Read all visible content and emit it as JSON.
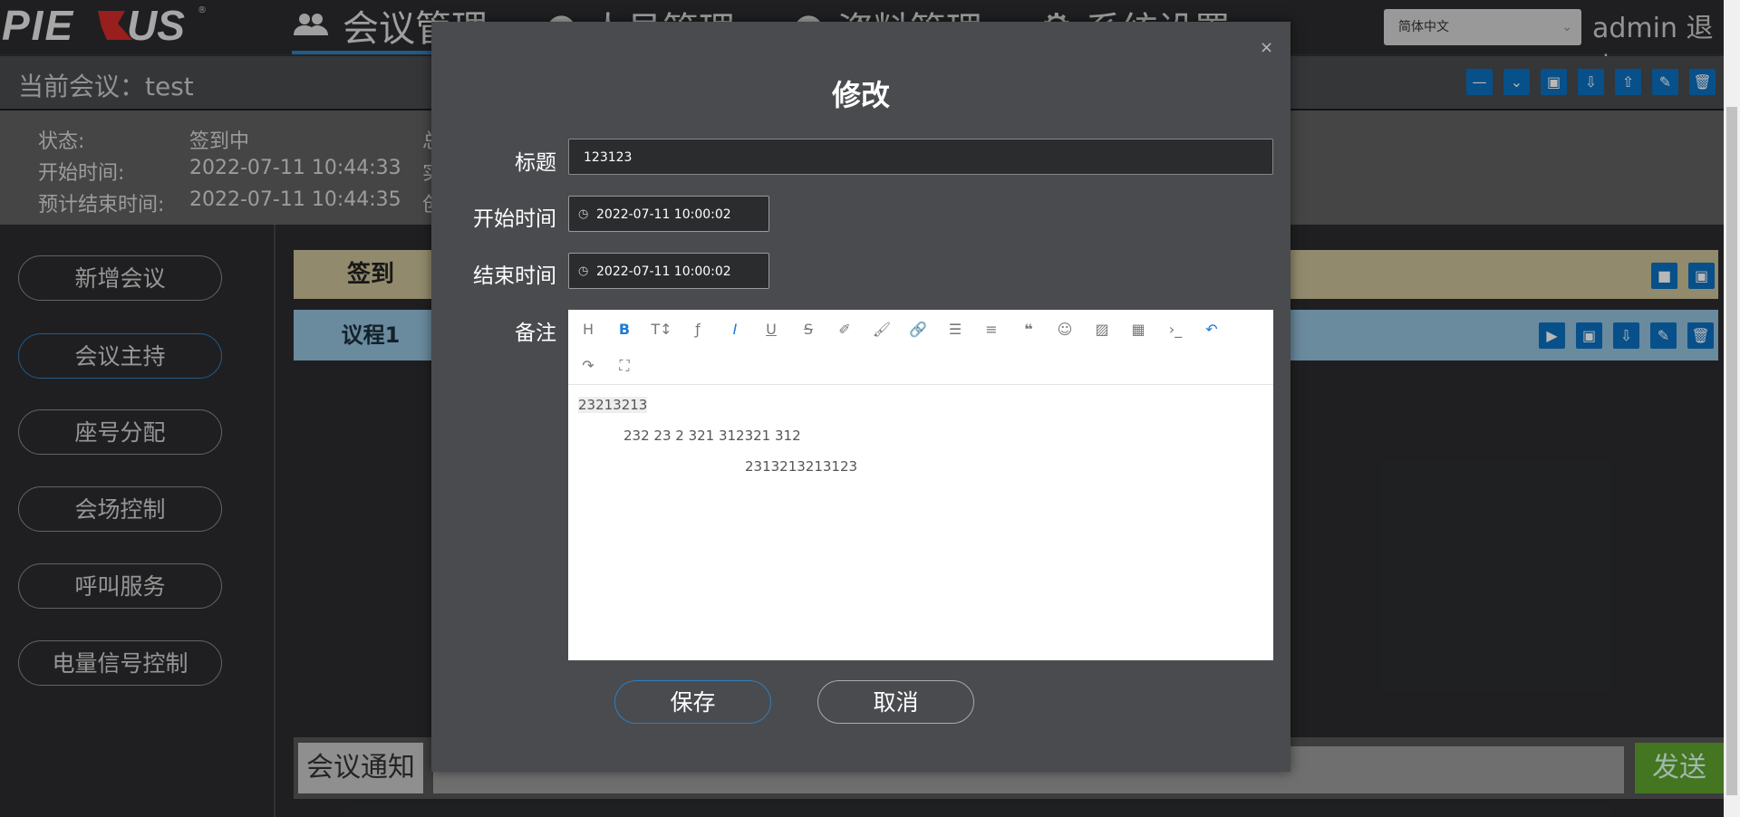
{
  "logo": "PIEXUS",
  "nav": [
    {
      "label": "会议管理",
      "icon": "users-icon"
    },
    {
      "label": "人员管理",
      "icon": "person-icon"
    },
    {
      "label": "资料管理",
      "icon": "person-icon"
    },
    {
      "label": "系统设置",
      "icon": "gear-icon"
    }
  ],
  "language": "简体中文",
  "user": {
    "name": "admin",
    "logout": "退出"
  },
  "conference": {
    "label": "当前会议：",
    "name": "test"
  },
  "info": {
    "status_key": "状态:",
    "status_val": "签到中",
    "start_key": "开始时间:",
    "start_val": "2022-07-11 10:44:33",
    "end_key": "预计结束时间:",
    "end_val": "2022-07-11 10:44:35",
    "col2_a": "总",
    "col2_b": "实",
    "col2_c": "创"
  },
  "sidebar": [
    {
      "label": "新增会议"
    },
    {
      "label": "会议主持"
    },
    {
      "label": "座号分配"
    },
    {
      "label": "会场控制"
    },
    {
      "label": "呼叫服务"
    },
    {
      "label": "电量信号控制"
    }
  ],
  "rows": {
    "signin": "签到",
    "agenda": "议程1"
  },
  "bottom": {
    "tag": "会议通知",
    "send": "发送"
  },
  "modal": {
    "title": "修改",
    "close": "×",
    "title_label": "标题",
    "title_value": "123123",
    "start_label": "开始时间",
    "start_value": "2022-07-11 10:00:02",
    "end_label": "结束时间",
    "end_value": "2022-07-11 10:00:02",
    "remark_label": "备注",
    "editor_lines": [
      "23213213",
      "232 23 2 321 312321 312",
      "2313213213123"
    ],
    "save": "保存",
    "cancel": "取消"
  },
  "colors": {
    "accent": "#2d7fc1",
    "tool_blue": "#0c6fbe",
    "signin_row": "#cabf98",
    "agenda_row": "#94c0da",
    "send_green": "#5fa32e"
  }
}
